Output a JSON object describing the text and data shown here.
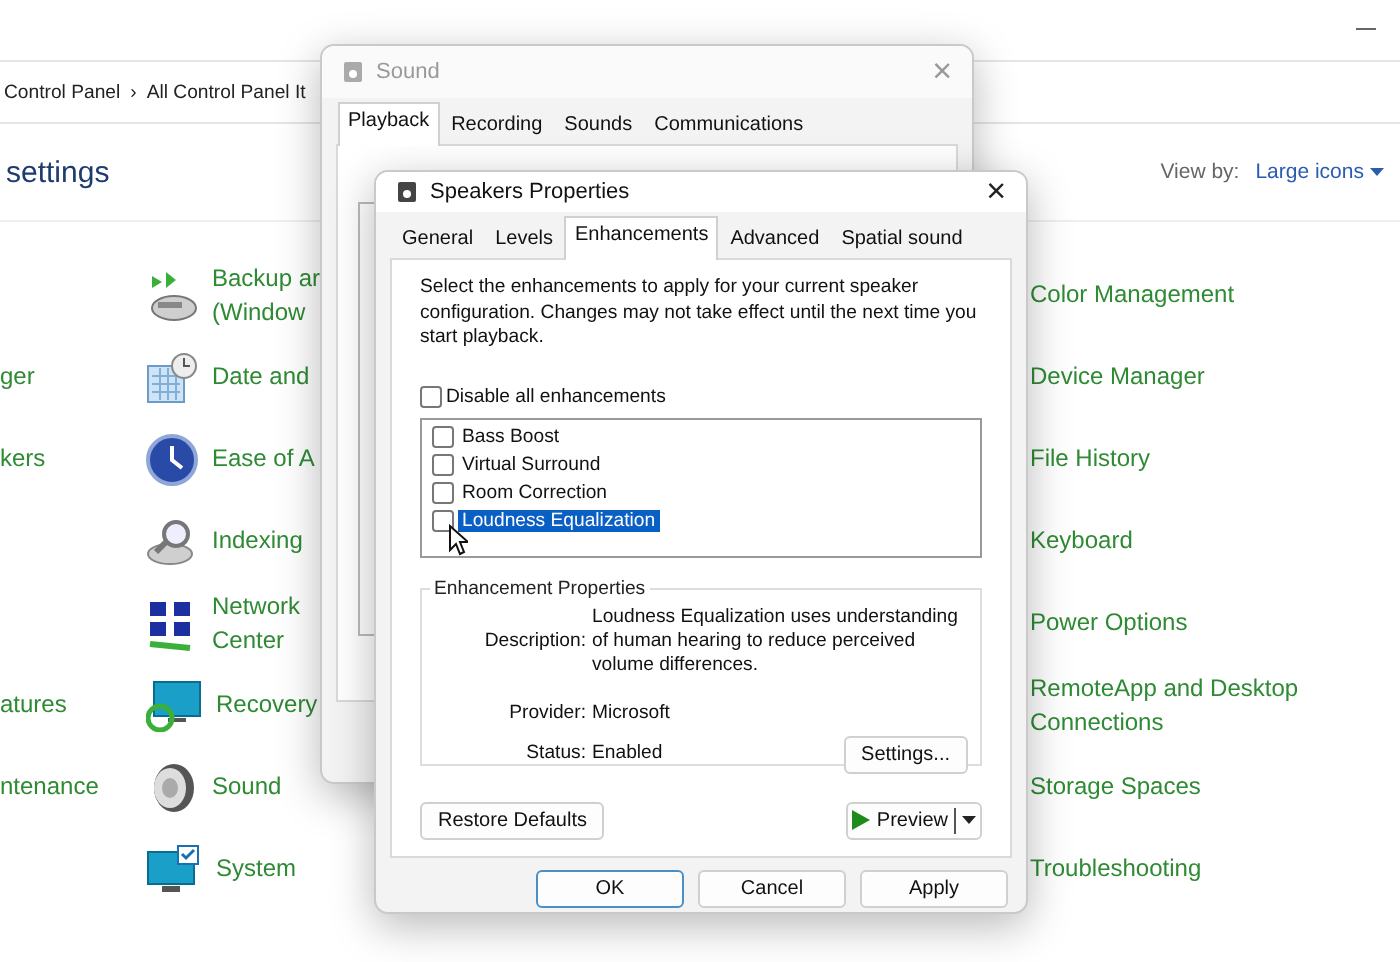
{
  "control_panel": {
    "breadcrumb": [
      "Control Panel",
      "›",
      "All Control Panel It"
    ],
    "title": "settings",
    "view_by": {
      "label": "View by:",
      "value": "Large icons"
    },
    "rows": [
      {
        "left": "",
        "middle": [
          "Backup ar",
          "(Window"
        ],
        "right": [
          "Color Management"
        ]
      },
      {
        "left": "ger",
        "middle": [
          "Date and"
        ],
        "right": [
          "Device Manager"
        ]
      },
      {
        "left": "kers",
        "middle": [
          "Ease of A"
        ],
        "right": [
          "File History"
        ]
      },
      {
        "left": "",
        "middle": [
          "Indexing"
        ],
        "right": [
          "Keyboard"
        ]
      },
      {
        "left": "",
        "middle": [
          "Network",
          "Center"
        ],
        "right": [
          "Power Options"
        ]
      },
      {
        "left": "atures",
        "middle": [
          "Recovery"
        ],
        "right": [
          "RemoteApp and Desktop",
          "Connections"
        ]
      },
      {
        "left": "ntenance",
        "middle": [
          "Sound"
        ],
        "right": [
          "Storage Spaces"
        ]
      },
      {
        "left": "",
        "middle": [
          "System"
        ],
        "right": [
          "Troubleshooting"
        ]
      }
    ]
  },
  "sound_dialog": {
    "title": "Sound",
    "close": "×",
    "tabs": [
      {
        "label": "Playback",
        "selected": true
      },
      {
        "label": "Recording",
        "selected": false
      },
      {
        "label": "Sounds",
        "selected": false
      },
      {
        "label": "Communications",
        "selected": false
      }
    ]
  },
  "speakers_dialog": {
    "title": "Speakers Properties",
    "close": "×",
    "tabs": [
      {
        "label": "General",
        "selected": false
      },
      {
        "label": "Levels",
        "selected": false
      },
      {
        "label": "Enhancements",
        "selected": true
      },
      {
        "label": "Advanced",
        "selected": false
      },
      {
        "label": "Spatial sound",
        "selected": false
      }
    ],
    "intro": "Select the enhancements to apply for your current speaker configuration. Changes may not take effect until the next time you start playback.",
    "disable_all": {
      "label": "Disable all enhancements",
      "checked": false
    },
    "enhancements": [
      {
        "label": "Bass Boost",
        "checked": false,
        "selected": false
      },
      {
        "label": "Virtual Surround",
        "checked": false,
        "selected": false
      },
      {
        "label": "Room Correction",
        "checked": false,
        "selected": false
      },
      {
        "label": "Loudness Equalization",
        "checked": false,
        "selected": true
      }
    ],
    "properties": {
      "legend": "Enhancement Properties",
      "fields": [
        {
          "label": "Description:",
          "value": "Loudness Equalization uses understanding of human hearing to reduce perceived volume differences."
        },
        {
          "label": "Provider:",
          "value": "Microsoft"
        },
        {
          "label": "Status:",
          "value": "Enabled"
        }
      ],
      "settings_button": "Settings..."
    },
    "restore_button": "Restore Defaults",
    "preview_button": "Preview",
    "buttons": [
      {
        "label": "OK",
        "default": true
      },
      {
        "label": "Cancel",
        "default": false
      },
      {
        "label": "Apply",
        "default": false
      }
    ]
  }
}
